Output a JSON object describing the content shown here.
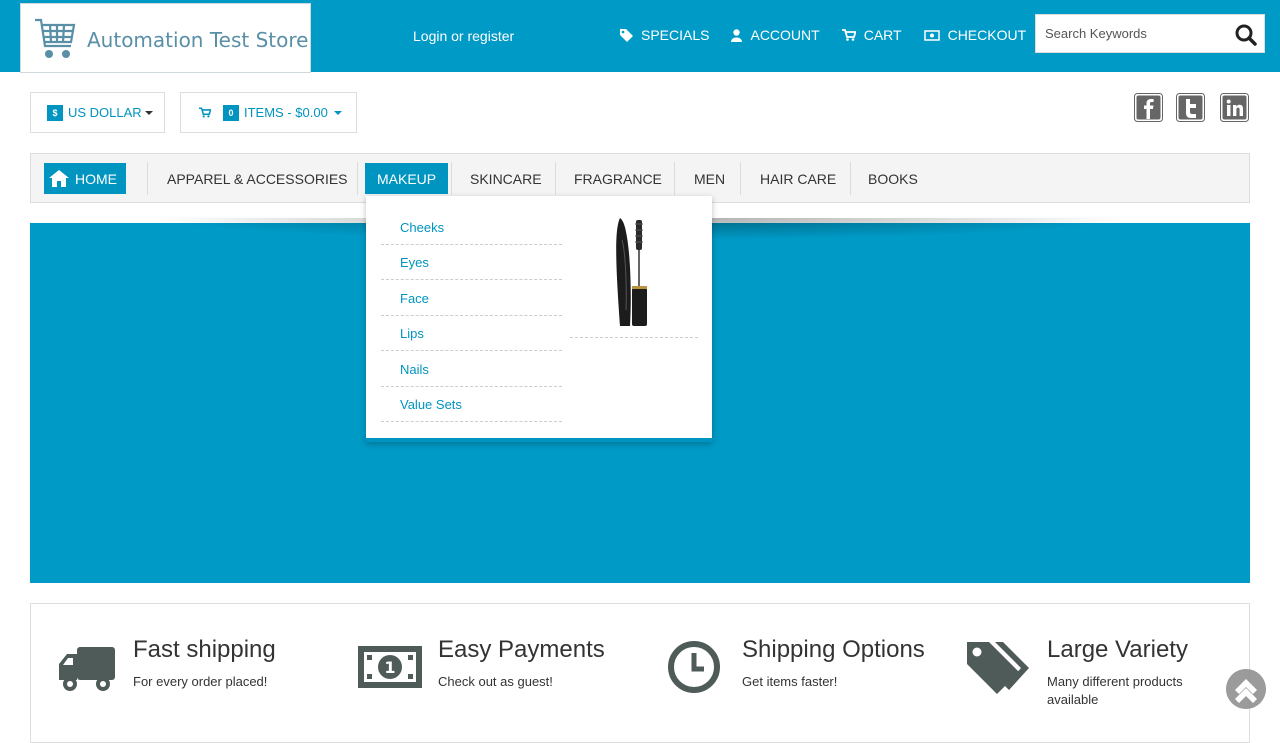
{
  "header": {
    "logo_text": "Automation Test Store",
    "login": "Login or register",
    "nav": [
      {
        "label": "SPECIALS",
        "icon": "tag-icon"
      },
      {
        "label": "ACCOUNT",
        "icon": "user-icon"
      },
      {
        "label": "CART",
        "icon": "cart-icon"
      },
      {
        "label": "CHECKOUT",
        "icon": "money-icon"
      }
    ],
    "search_placeholder": "Search Keywords"
  },
  "toolbar": {
    "currency_symbol": "$",
    "currency": "US DOLLAR",
    "cart_count": "0",
    "cart_summary": "ITEMS - $0.00"
  },
  "categories": {
    "home": "HOME",
    "items": [
      "APPAREL & ACCESSORIES",
      "MAKEUP",
      "SKINCARE",
      "FRAGRANCE",
      "MEN",
      "HAIR CARE",
      "BOOKS"
    ],
    "active": "MAKEUP"
  },
  "dropdown": {
    "items": [
      "Cheeks",
      "Eyes",
      "Face",
      "Lips",
      "Nails",
      "Value Sets"
    ]
  },
  "features": [
    {
      "title": "Fast shipping",
      "subtitle": "For every order placed!",
      "icon": "truck-icon"
    },
    {
      "title": "Easy Payments",
      "subtitle": "Check out as guest!",
      "icon": "banknote-icon"
    },
    {
      "title": "Shipping Options",
      "subtitle": "Get items faster!",
      "icon": "clock-icon"
    },
    {
      "title": "Large Variety",
      "subtitle": "Many different products available",
      "icon": "tags-icon"
    }
  ],
  "colors": {
    "brand": "#009ac6",
    "accent": "#0095c0",
    "text": "#333333",
    "icon_gray": "#4f5b58"
  }
}
